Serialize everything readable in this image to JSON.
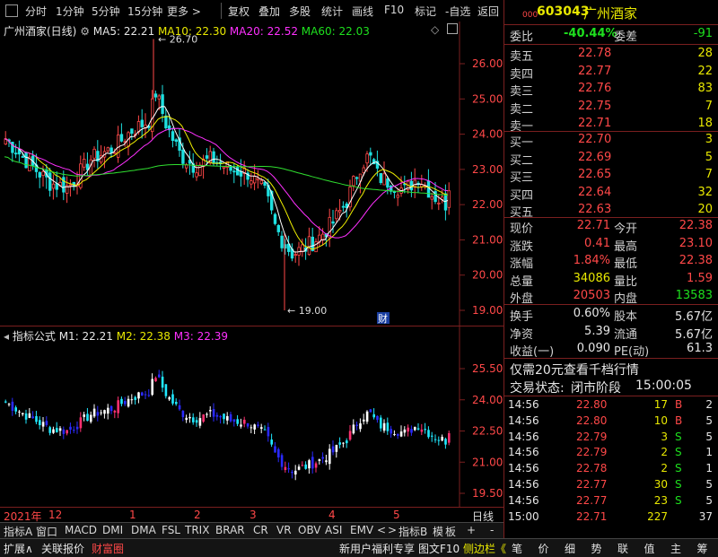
{
  "toolbar": {
    "items": [
      "分时",
      "1分钟",
      "5分钟",
      "15分钟",
      "更多 >",
      "复权",
      "叠加",
      "多股",
      "统计",
      "画线",
      "F10",
      "标记",
      "-自选",
      "返回"
    ]
  },
  "stock": {
    "code": "603043",
    "code_prefix": "000",
    "name": "广州酒家"
  },
  "main_legend": {
    "title": "广州酒家(日线)",
    "ma5": "MA5: 22.21",
    "ma10": "MA10: 22.30",
    "ma20": "MA20: 22.52",
    "ma60": "MA60: 22.03"
  },
  "main_axis": {
    "ticks": [
      "26.00",
      "25.00",
      "24.00",
      "23.00",
      "22.00",
      "21.00",
      "20.00",
      "19.00"
    ],
    "high_label": "26.70",
    "low_label": "19.00",
    "badge": "财"
  },
  "sub_legend": {
    "title": "指标公式",
    "m1": "M1: 22.21",
    "m2": "M2: 22.38",
    "m3": "M3: 22.39"
  },
  "sub_axis": {
    "ticks": [
      "25.50",
      "24.00",
      "22.50",
      "21.00",
      "19.50"
    ]
  },
  "date_axis": {
    "labels": [
      "2021年",
      "12",
      "1",
      "2",
      "3",
      "4",
      "5"
    ],
    "period": "日线"
  },
  "orderbook": {
    "weibi_label": "委比",
    "weibi_value": "-40.44%",
    "weicha_label": "委差",
    "weicha_value": "-91",
    "asks": [
      {
        "label": "卖五",
        "price": "22.78",
        "vol": "28"
      },
      {
        "label": "卖四",
        "price": "22.77",
        "vol": "22"
      },
      {
        "label": "卖三",
        "price": "22.76",
        "vol": "83"
      },
      {
        "label": "卖二",
        "price": "22.75",
        "vol": "7"
      },
      {
        "label": "卖一",
        "price": "22.71",
        "vol": "18"
      }
    ],
    "bids": [
      {
        "label": "买一",
        "price": "22.70",
        "vol": "3"
      },
      {
        "label": "买二",
        "price": "22.69",
        "vol": "5"
      },
      {
        "label": "买三",
        "price": "22.65",
        "vol": "7"
      },
      {
        "label": "买四",
        "price": "22.64",
        "vol": "32"
      },
      {
        "label": "买五",
        "price": "22.63",
        "vol": "20"
      }
    ]
  },
  "quote": {
    "rows": [
      {
        "l1": "现价",
        "v1": "22.71",
        "l2": "今开",
        "v2": "22.38",
        "c1": "red",
        "c2": "red"
      },
      {
        "l1": "涨跌",
        "v1": "0.41",
        "l2": "最高",
        "v2": "23.10",
        "c1": "red",
        "c2": "red"
      },
      {
        "l1": "涨幅",
        "v1": "1.84%",
        "l2": "最低",
        "v2": "22.38",
        "c1": "red",
        "c2": "red"
      },
      {
        "l1": "总量",
        "v1": "34086",
        "l2": "量比",
        "v2": "1.59",
        "c1": "yellow",
        "c2": "red"
      },
      {
        "l1": "外盘",
        "v1": "20503",
        "l2": "内盘",
        "v2": "13583",
        "c1": "red",
        "c2": "green"
      }
    ],
    "rows2": [
      {
        "l1": "换手",
        "v1": "0.60%",
        "l2": "股本",
        "v2": "5.67亿"
      },
      {
        "l1": "净资",
        "v1": "5.39",
        "l2": "流通",
        "v2": "5.67亿"
      },
      {
        "l1": "收益(一)",
        "v1": "0.090",
        "l2": "PE(动)",
        "v2": "61.3"
      }
    ]
  },
  "promo": "仅需20元查看千档行情",
  "trade_status": {
    "label": "交易状态:",
    "state": "闭市阶段",
    "time": "15:00:05"
  },
  "ticks": [
    {
      "t": "14:56",
      "p": "22.80",
      "v": "17",
      "s": "B",
      "n": "2"
    },
    {
      "t": "14:56",
      "p": "22.80",
      "v": "10",
      "s": "B",
      "n": "5"
    },
    {
      "t": "14:56",
      "p": "22.79",
      "v": "3",
      "s": "S",
      "n": "5"
    },
    {
      "t": "14:56",
      "p": "22.79",
      "v": "2",
      "s": "S",
      "n": "1"
    },
    {
      "t": "14:56",
      "p": "22.78",
      "v": "2",
      "s": "S",
      "n": "1"
    },
    {
      "t": "14:56",
      "p": "22.77",
      "v": "30",
      "s": "S",
      "n": "5"
    },
    {
      "t": "14:56",
      "p": "22.77",
      "v": "23",
      "s": "S",
      "n": "5"
    },
    {
      "t": "15:00",
      "p": "22.71",
      "v": "227",
      "s": "",
      "n": "37"
    }
  ],
  "indicator_tabs": [
    "指标A",
    "窗口",
    "MACD",
    "DMI",
    "DMA",
    "FSL",
    "TRIX",
    "BRAR",
    "CR",
    "VR",
    "OBV",
    "ASI",
    "EMV",
    "<",
    ">",
    "指标B",
    "模",
    "板",
    "+",
    "-"
  ],
  "bottom_bar": {
    "left": [
      "扩展∧",
      "关联报价",
      "财富圈"
    ],
    "right": [
      "新用户福利专享",
      "图文F10",
      "侧边栏《"
    ],
    "buttons": [
      "笔",
      "价",
      "细",
      "势",
      "联",
      "值",
      "主",
      "筹"
    ]
  },
  "colors": {
    "up": "#ff4848",
    "down": "#1ee0e0",
    "ma5": "#ffffff",
    "ma10": "#f0f000",
    "ma20": "#ff30ff",
    "ma60": "#30e030",
    "panel_border": "#7a1f1f"
  }
}
